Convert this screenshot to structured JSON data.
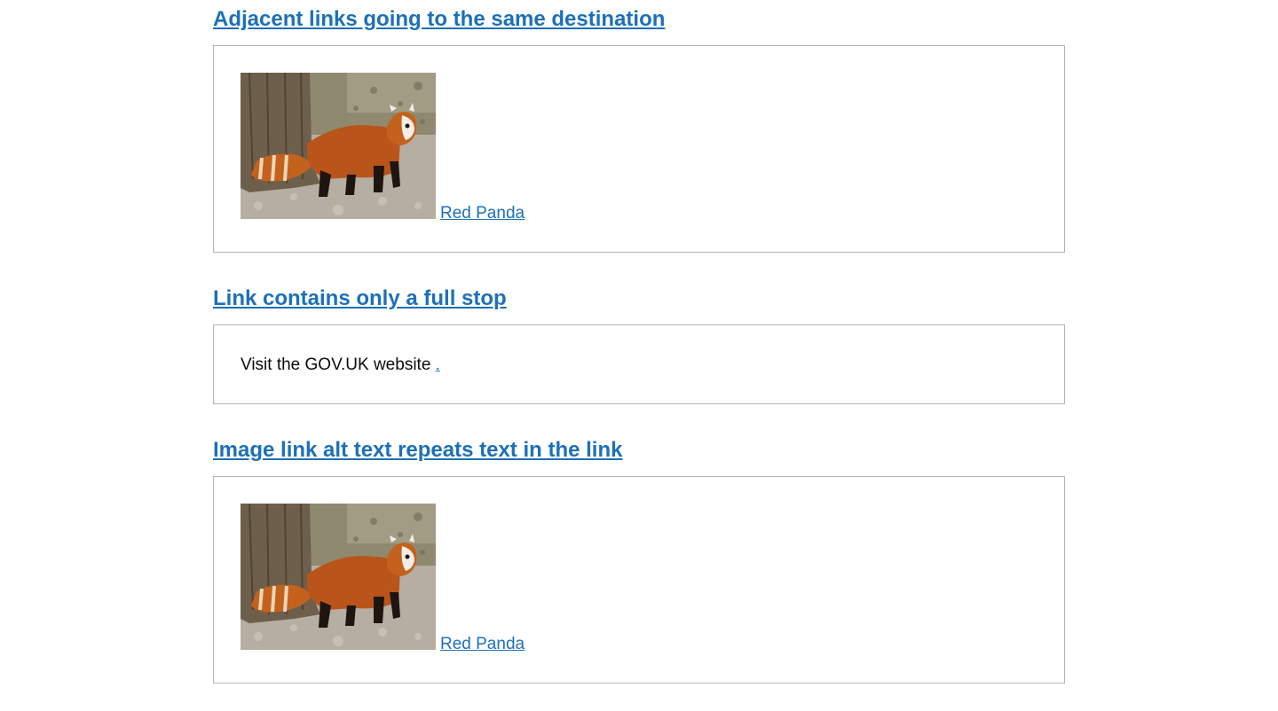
{
  "sections": [
    {
      "heading": "Adjacent links going to the same destination",
      "link_text": "Red Panda",
      "image": "red-panda-photo"
    },
    {
      "heading": "Link contains only a full stop",
      "text_before": "Visit the GOV.UK website ",
      "link_text": "."
    },
    {
      "heading": "Image link alt text repeats text in the link",
      "link_text": "Red Panda",
      "image": "red-panda-photo"
    }
  ],
  "colors": {
    "link": "#1d70b8",
    "text": "#0b0c0c",
    "border": "#b1b4b6"
  }
}
